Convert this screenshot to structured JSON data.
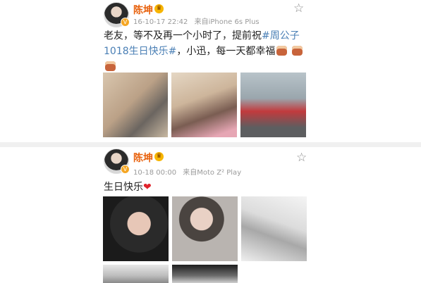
{
  "posts": [
    {
      "author": "陈坤",
      "timestamp": "16-10-17 22:42",
      "source": "来自iPhone 6s Plus",
      "text_prefix": "老友，等不及再一个小时了，提前祝",
      "topic": "#周公子1018生日快乐#",
      "text_suffix": "，小迅，每一天都幸福",
      "photo_count": 3
    },
    {
      "author": "陈坤",
      "timestamp": "10-18 00:00",
      "source": "来自Moto Z² Play",
      "text": "生日快乐",
      "photo_count": 5
    }
  ],
  "icons": {
    "favorite": "star-outline-icon",
    "verified": "verified-badge-icon",
    "member": "crown-icon",
    "cake": "cake-emoji",
    "heart": "heart-emoji"
  },
  "colors": {
    "author_name": "#e8610c",
    "topic_link": "#4a7fb5",
    "meta_text": "#9a9a9a"
  }
}
